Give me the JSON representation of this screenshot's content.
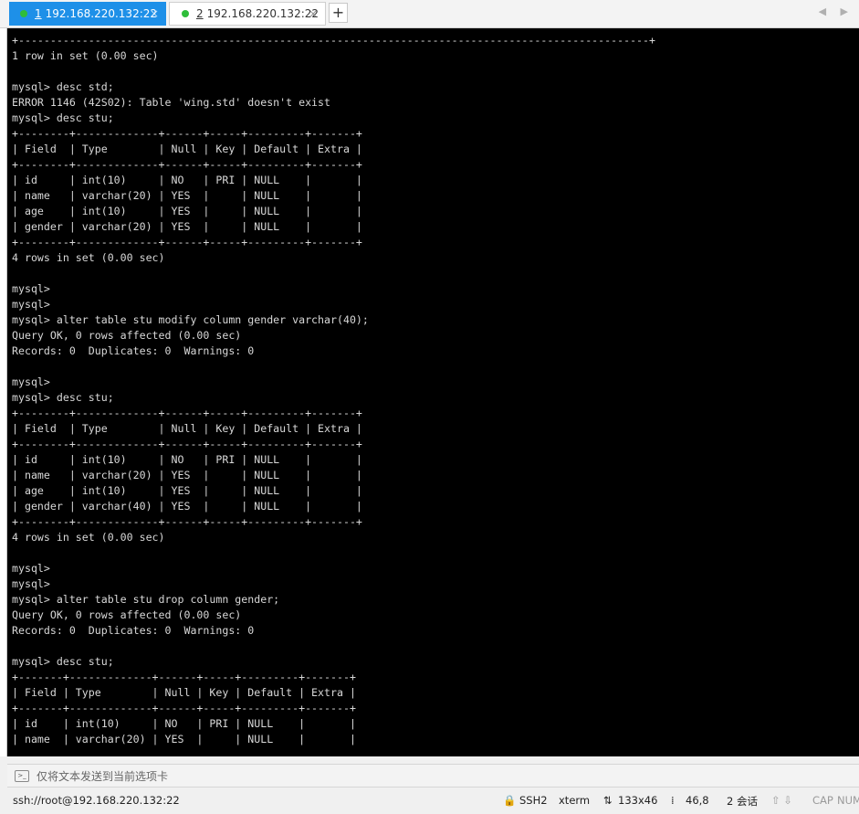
{
  "tabs": [
    {
      "number": "1",
      "title": "192.168.220.132:22",
      "close": "×"
    },
    {
      "number": "2",
      "title": "192.168.220.132:22",
      "close": "×"
    }
  ],
  "new_tab_label": "+",
  "tab_nav": "◀ ▶",
  "terminal_lines": [
    "+---------------------------------------------------------------------------------------------------+",
    "1 row in set (0.00 sec)",
    "",
    "mysql> desc std;",
    "ERROR 1146 (42S02): Table 'wing.std' doesn't exist",
    "mysql> desc stu;",
    "+--------+-------------+------+-----+---------+-------+",
    "| Field  | Type        | Null | Key | Default | Extra |",
    "+--------+-------------+------+-----+---------+-------+",
    "| id     | int(10)     | NO   | PRI | NULL    |       |",
    "| name   | varchar(20) | YES  |     | NULL    |       |",
    "| age    | int(10)     | YES  |     | NULL    |       |",
    "| gender | varchar(20) | YES  |     | NULL    |       |",
    "+--------+-------------+------+-----+---------+-------+",
    "4 rows in set (0.00 sec)",
    "",
    "mysql>",
    "mysql>",
    "mysql> alter table stu modify column gender varchar(40);",
    "Query OK, 0 rows affected (0.00 sec)",
    "Records: 0  Duplicates: 0  Warnings: 0",
    "",
    "mysql>",
    "mysql> desc stu;",
    "+--------+-------------+------+-----+---------+-------+",
    "| Field  | Type        | Null | Key | Default | Extra |",
    "+--------+-------------+------+-----+---------+-------+",
    "| id     | int(10)     | NO   | PRI | NULL    |       |",
    "| name   | varchar(20) | YES  |     | NULL    |       |",
    "| age    | int(10)     | YES  |     | NULL    |       |",
    "| gender | varchar(40) | YES  |     | NULL    |       |",
    "+--------+-------------+------+-----+---------+-------+",
    "4 rows in set (0.00 sec)",
    "",
    "mysql>",
    "mysql>",
    "mysql> alter table stu drop column gender;",
    "Query OK, 0 rows affected (0.00 sec)",
    "Records: 0  Duplicates: 0  Warnings: 0",
    "",
    "mysql> desc stu;",
    "+-------+-------------+------+-----+---------+-------+",
    "| Field | Type        | Null | Key | Default | Extra |",
    "+-------+-------------+------+-----+---------+-------+",
    "| id    | int(10)     | NO   | PRI | NULL    |       |",
    "| name  | varchar(20) | YES  |     | NULL    |       |"
  ],
  "send_bar": {
    "icon": ">_",
    "placeholder": "仅将文本发送到当前选项卡"
  },
  "status": {
    "connection": "ssh://root@192.168.220.132:22",
    "protocol": "🔒 SSH2",
    "term": "xterm",
    "size": "133x46",
    "cursor": "46,8",
    "sessions": "2 会话",
    "arrows": "⇧ ⇩",
    "cap": "CAP",
    "num": "NUM"
  }
}
